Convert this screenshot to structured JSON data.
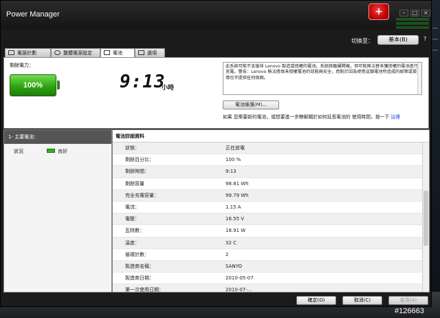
{
  "window": {
    "title": "Power Manager"
  },
  "switch": {
    "label": "切換至：",
    "value": "基本(B)",
    "help": "?"
  },
  "tabs": [
    {
      "label": "電源計劃"
    },
    {
      "label": "整體電源設定"
    },
    {
      "label": "電池"
    },
    {
      "label": "選項"
    }
  ],
  "battery": {
    "remaining_label": "剩餘電力：",
    "percent": "100%",
    "time": "9:13",
    "time_unit": "小時",
    "notice": "此系統可能不支援非 Lenovo 製造或授權的電池。系統將繼續開機，但可能無法替未獲授權的電池進行充電。警告：Lenovo 無法擔保未授權電池的效能與安全，而對於因為使用這類電池所造成的故障或損壞也不提供任何保固。",
    "maint_button": "電池維護(M)...",
    "maint_note": "如果 您需要新的電池，或想要進一步瞭解關於如何延長電池的 使用時間，按一下",
    "maint_link": "這裡"
  },
  "status": {
    "header": "1- 主要電池：",
    "label": "狀況",
    "value": "良好"
  },
  "details": {
    "title": "電池詳細資料",
    "rows": [
      {
        "k": "狀態：",
        "v": "正在放電"
      },
      {
        "k": "剩餘百分比：",
        "v": "100 %"
      },
      {
        "k": "剩餘時間：",
        "v": "9:13"
      },
      {
        "k": "剩餘容量",
        "v": "98.81 Wh"
      },
      {
        "k": "完全充電容量：",
        "v": "99.79 Wh"
      },
      {
        "k": "電流：",
        "v": "1.15 A"
      },
      {
        "k": "電壓：",
        "v": "16.55 V"
      },
      {
        "k": "瓦特數：",
        "v": "18.91 W"
      },
      {
        "k": "溫度：",
        "v": "32 C"
      },
      {
        "k": "循環計數：",
        "v": "2"
      },
      {
        "k": "製造商名稱：",
        "v": "SANYO"
      },
      {
        "k": "製造商日期：",
        "v": "2010-05-07"
      },
      {
        "k": "第一次使用日期：",
        "v": "2010-07-..."
      }
    ]
  },
  "footer": {
    "ok": "確定(O)",
    "cancel": "取消(C)",
    "apply": "套用(A)"
  },
  "watermark": "#126663"
}
